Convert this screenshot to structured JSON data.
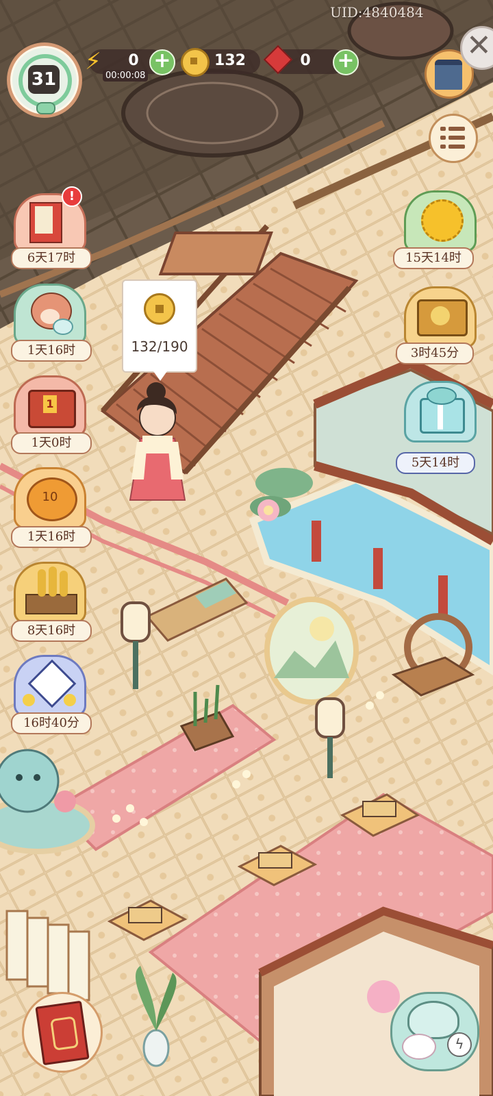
{
  "uid": "UID:4840484",
  "player": {
    "level": "31"
  },
  "resources": {
    "energy": {
      "value": "0",
      "timer": "00:00:08",
      "icon": "lightning-icon"
    },
    "coins": {
      "value": "132",
      "icon": "copper-coin-icon"
    },
    "gems": {
      "value": "0",
      "icon": "red-gem-icon"
    }
  },
  "coin_bubble": {
    "text": "132/190"
  },
  "left_events": [
    {
      "name": "imperial-decree-event",
      "timer": "6天17时",
      "alert": "!"
    },
    {
      "name": "monkey-event",
      "timer": "1天16时"
    },
    {
      "name": "treasure-chest-event",
      "timer": "1天0时",
      "tag": "1"
    },
    {
      "name": "pumpkin-event",
      "timer": "1天16时",
      "tag": "10"
    },
    {
      "name": "wheat-harvest-event",
      "timer": "8天16时"
    },
    {
      "name": "kite-event",
      "timer": "16时40分"
    }
  ],
  "right_events": [
    {
      "name": "chrysanthemum-event",
      "timer": "15天14时"
    },
    {
      "name": "mooncake-box-event",
      "timer": "3时45分"
    },
    {
      "name": "gift-box-event",
      "timer": "5天14时"
    }
  ],
  "colors": {
    "panel_dark": "#3c2a28",
    "plus_green": "#78c264",
    "label_border": "#b3785a",
    "label_bg": "#fbf3e2",
    "pool_blue": "#8fd4e8"
  }
}
